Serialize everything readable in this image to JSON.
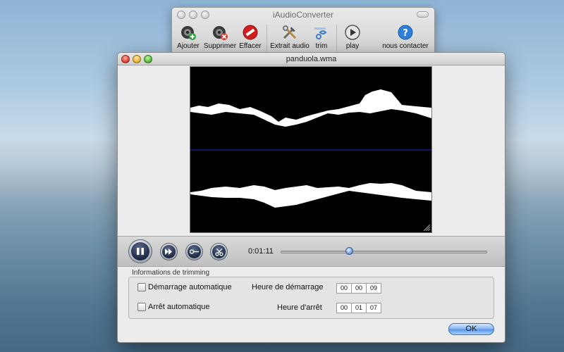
{
  "back_window": {
    "title": "iAudioConverter",
    "toolbar": [
      {
        "label": "Ajouter",
        "icon": "add-speaker-icon"
      },
      {
        "label": "Supprimer",
        "icon": "remove-speaker-icon"
      },
      {
        "label": "Effacer",
        "icon": "clear-icon"
      },
      {
        "label": "Extrait audio",
        "icon": "tools-icon"
      },
      {
        "label": "trim",
        "icon": "trim-icon"
      },
      {
        "label": "play",
        "icon": "play-icon"
      },
      {
        "label": "nous contacter",
        "icon": "help-icon"
      }
    ]
  },
  "front_window": {
    "title": "panduola.wma",
    "playback": {
      "time": "0:01:11",
      "position_fraction": 0.33
    },
    "trimming": {
      "group_title": "Informations de trimming",
      "auto_start_label": "Démarrage automatique",
      "auto_stop_label": "Arrêt automatique",
      "start_time_label": "Heure de démarrage",
      "stop_time_label": "Heure d'arrêt",
      "start_time": [
        "00",
        "00",
        "09"
      ],
      "stop_time": [
        "00",
        "01",
        "07"
      ]
    },
    "ok_label": "OK"
  },
  "colors": {
    "accent": "#5c97e6",
    "wave_center_line": "#1a2fd4"
  }
}
